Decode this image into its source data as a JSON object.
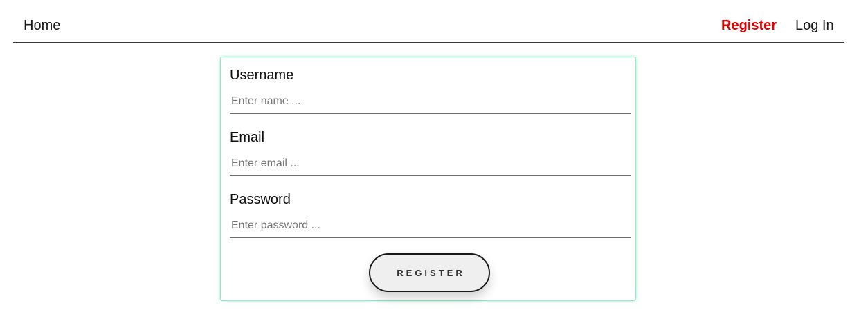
{
  "nav": {
    "home_label": "Home",
    "register_label": "Register",
    "login_label": "Log In",
    "active_color": "#e00000"
  },
  "form": {
    "username": {
      "label": "Username",
      "placeholder": "Enter name ...",
      "value": ""
    },
    "email": {
      "label": "Email",
      "placeholder": "Enter email ...",
      "value": ""
    },
    "password": {
      "label": "Password",
      "placeholder": "Enter password ...",
      "value": ""
    },
    "submit_label": "REGISTER",
    "border_color": "#8fe8c4"
  }
}
